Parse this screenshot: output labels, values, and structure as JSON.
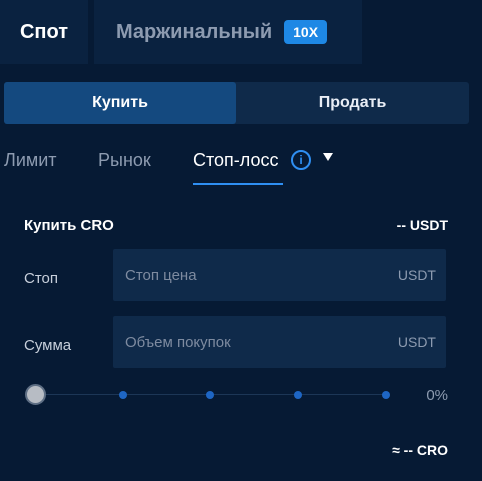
{
  "top_tabs": {
    "spot": "Спот",
    "margin": "Маржинальный",
    "leverage_badge": "10X"
  },
  "side_tabs": {
    "buy": "Купить",
    "sell": "Продать"
  },
  "order_types": {
    "limit": "Лимит",
    "market": "Рынок",
    "stop_loss": "Стоп-лосс",
    "info_glyph": "i",
    "active": "Стоп-лосс"
  },
  "form": {
    "title": "Купить CRO",
    "balance": "-- USDT",
    "stop": {
      "label": "Стоп",
      "placeholder": "Стоп цена",
      "value": "",
      "unit": "USDT"
    },
    "amount": {
      "label": "Сумма",
      "placeholder": "Объем покупок",
      "value": "",
      "unit": "USDT"
    },
    "slider": {
      "percent_label": "0%",
      "value_fraction": 0
    },
    "estimate": "≈ -- CRO"
  },
  "colors": {
    "background": "#061a34",
    "panel": "#0a2240",
    "accent": "#2f8ff2",
    "buy_active": "#14497f",
    "muted_text": "#8d9bb0"
  },
  "icons": [
    "info-icon",
    "caret-down-icon"
  ]
}
